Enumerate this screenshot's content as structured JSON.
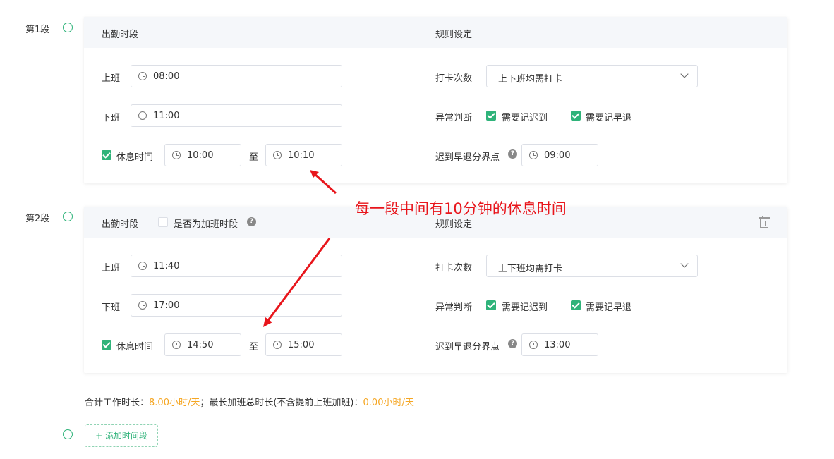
{
  "segments": [
    {
      "label": "第1段",
      "head_left": "出勤时段",
      "head_right": "规则设定",
      "on_label": "上班",
      "on_time": "08:00",
      "off_label": "下班",
      "off_time": "11:00",
      "break_label": "休息时间",
      "break_start": "10:00",
      "break_to": "至",
      "break_end": "10:10",
      "punch_label": "打卡次数",
      "punch_value": "上下班均需打卡",
      "abnormal_label": "异常判断",
      "late_label": "需要记迟到",
      "early_label": "需要记早退",
      "boundary_label": "迟到早退分界点",
      "boundary_time": "09:00"
    },
    {
      "label": "第2段",
      "head_left": "出勤时段",
      "overtime_label": "是否为加班时段",
      "head_right": "规则设定",
      "on_label": "上班",
      "on_time": "11:40",
      "off_label": "下班",
      "off_time": "17:00",
      "break_label": "休息时间",
      "break_start": "14:50",
      "break_to": "至",
      "break_end": "15:00",
      "punch_label": "打卡次数",
      "punch_value": "上下班均需打卡",
      "abnormal_label": "异常判断",
      "late_label": "需要记迟到",
      "early_label": "需要记早退",
      "boundary_label": "迟到早退分界点",
      "boundary_time": "13:00"
    }
  ],
  "summary": {
    "total_label": "合计工作时长：",
    "total_value": "8.00小时/天",
    "sep": "；",
    "overtime_label": "最长加班总时长(不含提前上班加班)：",
    "overtime_value": "0.00小时/天"
  },
  "add_button": "+ 添加时间段",
  "annotation": "每一段中间有10分钟的休息时间",
  "colors": {
    "accent": "#2fb37a",
    "orange": "#f5a623",
    "annotation": "#e8151b"
  }
}
